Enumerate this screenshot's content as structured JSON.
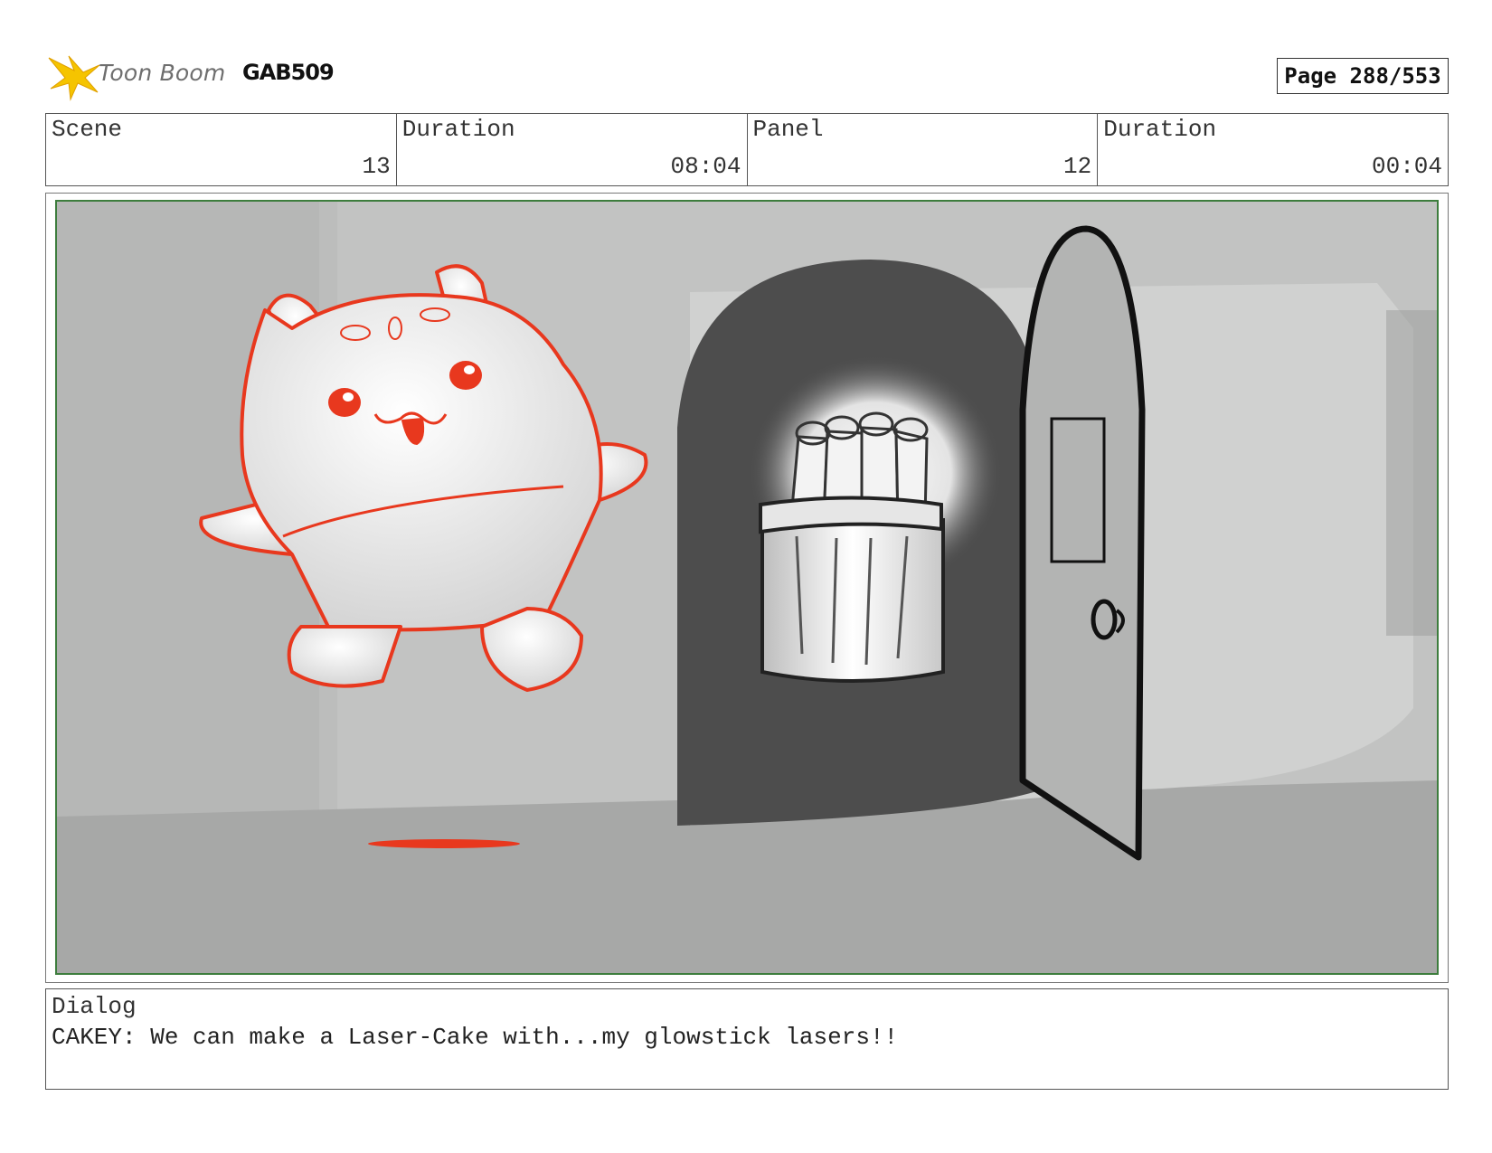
{
  "header": {
    "logo_text": "Toon Boom",
    "production_code": "GAB509",
    "page_label": "Page 288/553"
  },
  "info": {
    "scene_label": "Scene",
    "scene_value": "13",
    "scene_duration_label": "Duration",
    "scene_duration_value": "08:04",
    "panel_label": "Panel",
    "panel_value": "12",
    "panel_duration_label": "Duration",
    "panel_duration_value": "00:04"
  },
  "dialog": {
    "label": "Dialog",
    "text": "CAKEY: We can make a Laser-Cake with...my glowstick lasers!!"
  },
  "colors": {
    "sketch_red": "#e8381e",
    "panel_border": "#3d7d3d",
    "logo_yellow": "#f5c400"
  }
}
